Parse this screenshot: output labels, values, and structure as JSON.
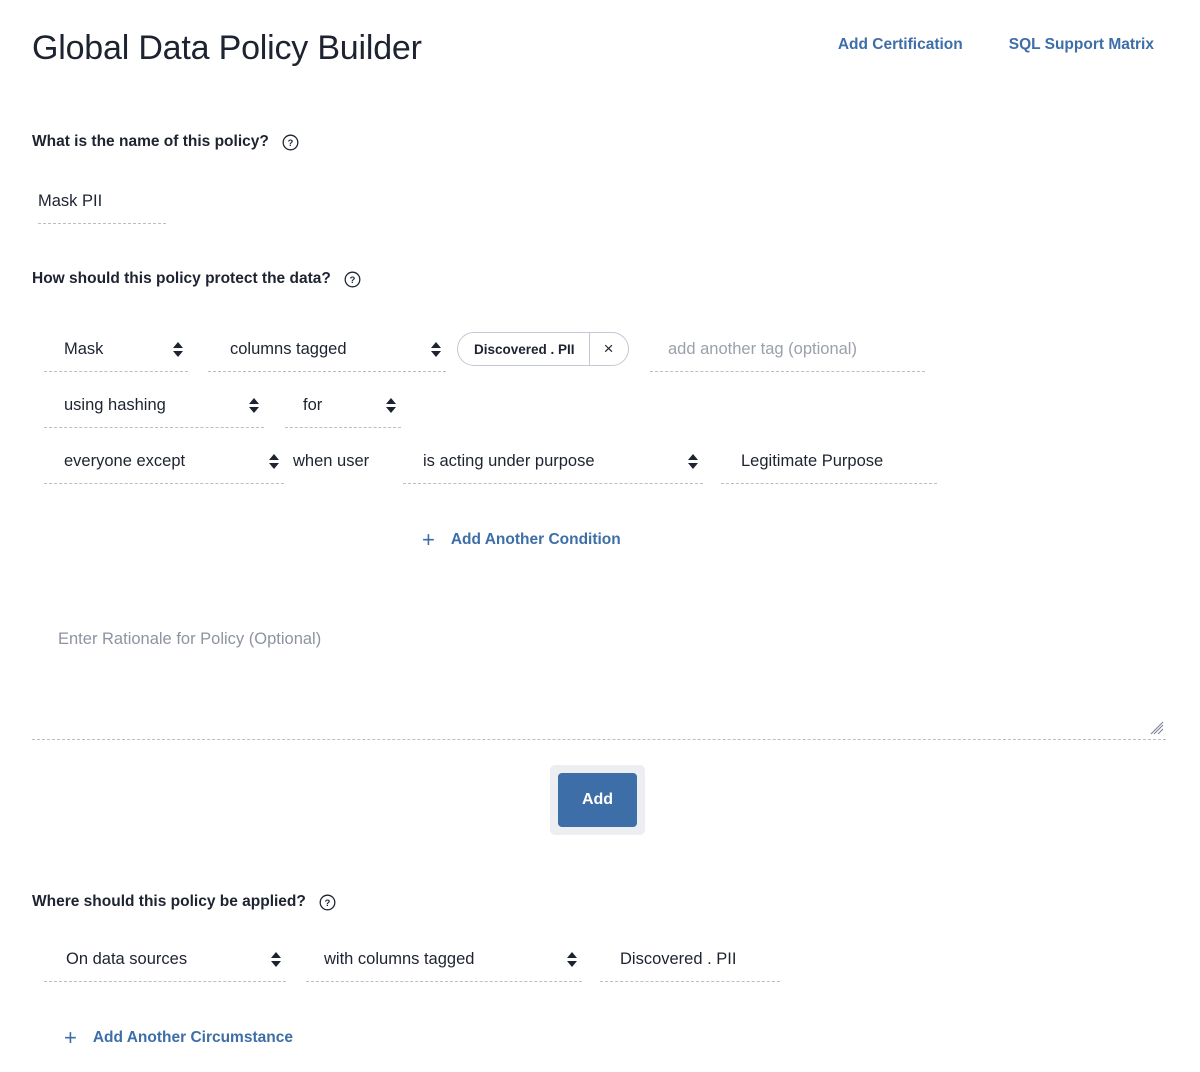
{
  "header": {
    "title": "Global Data Policy Builder",
    "links": [
      {
        "label": "Add Certification",
        "name": "add-certification-link"
      },
      {
        "label": "SQL Support Matrix",
        "name": "sql-support-matrix-link"
      }
    ]
  },
  "colors": {
    "accent_blue": "#3d6ea8",
    "text_dark": "#1d2330",
    "placeholder_gray": "#9aa0ab",
    "dashed_border": "#b9bec9",
    "button_focus_ring": "#eceef1"
  },
  "sections": {
    "policy_name": {
      "label": "What is the name of this policy?",
      "help_icon": "help-circle-icon",
      "value": "Mask PII"
    },
    "protection": {
      "label": "How should this policy protect the data?",
      "help_icon": "help-circle-icon",
      "row1": {
        "action": "Mask",
        "target": "columns tagged",
        "tag_chip": "Discovered . PII",
        "tag_chip_remove": "×",
        "tag_input_placeholder": "add another tag (optional)"
      },
      "row2": {
        "method": "using hashing",
        "connector": "for"
      },
      "row3": {
        "audience": "everyone except",
        "static_label": "when user",
        "condition": "is acting under purpose",
        "purpose_value": "Legitimate Purpose"
      },
      "add_condition": {
        "plus": "+",
        "label": "Add Another Condition"
      }
    },
    "rationale": {
      "placeholder": "Enter Rationale for Policy (Optional)"
    },
    "submit": {
      "label": "Add"
    },
    "application": {
      "label": "Where should this policy be applied?",
      "help_icon": "help-circle-icon",
      "row1": {
        "scope": "On data sources",
        "filter": "with columns tagged",
        "tag_value": "Discovered . PII"
      },
      "add_circumstance": {
        "plus": "+",
        "label": "Add Another Circumstance"
      }
    }
  }
}
